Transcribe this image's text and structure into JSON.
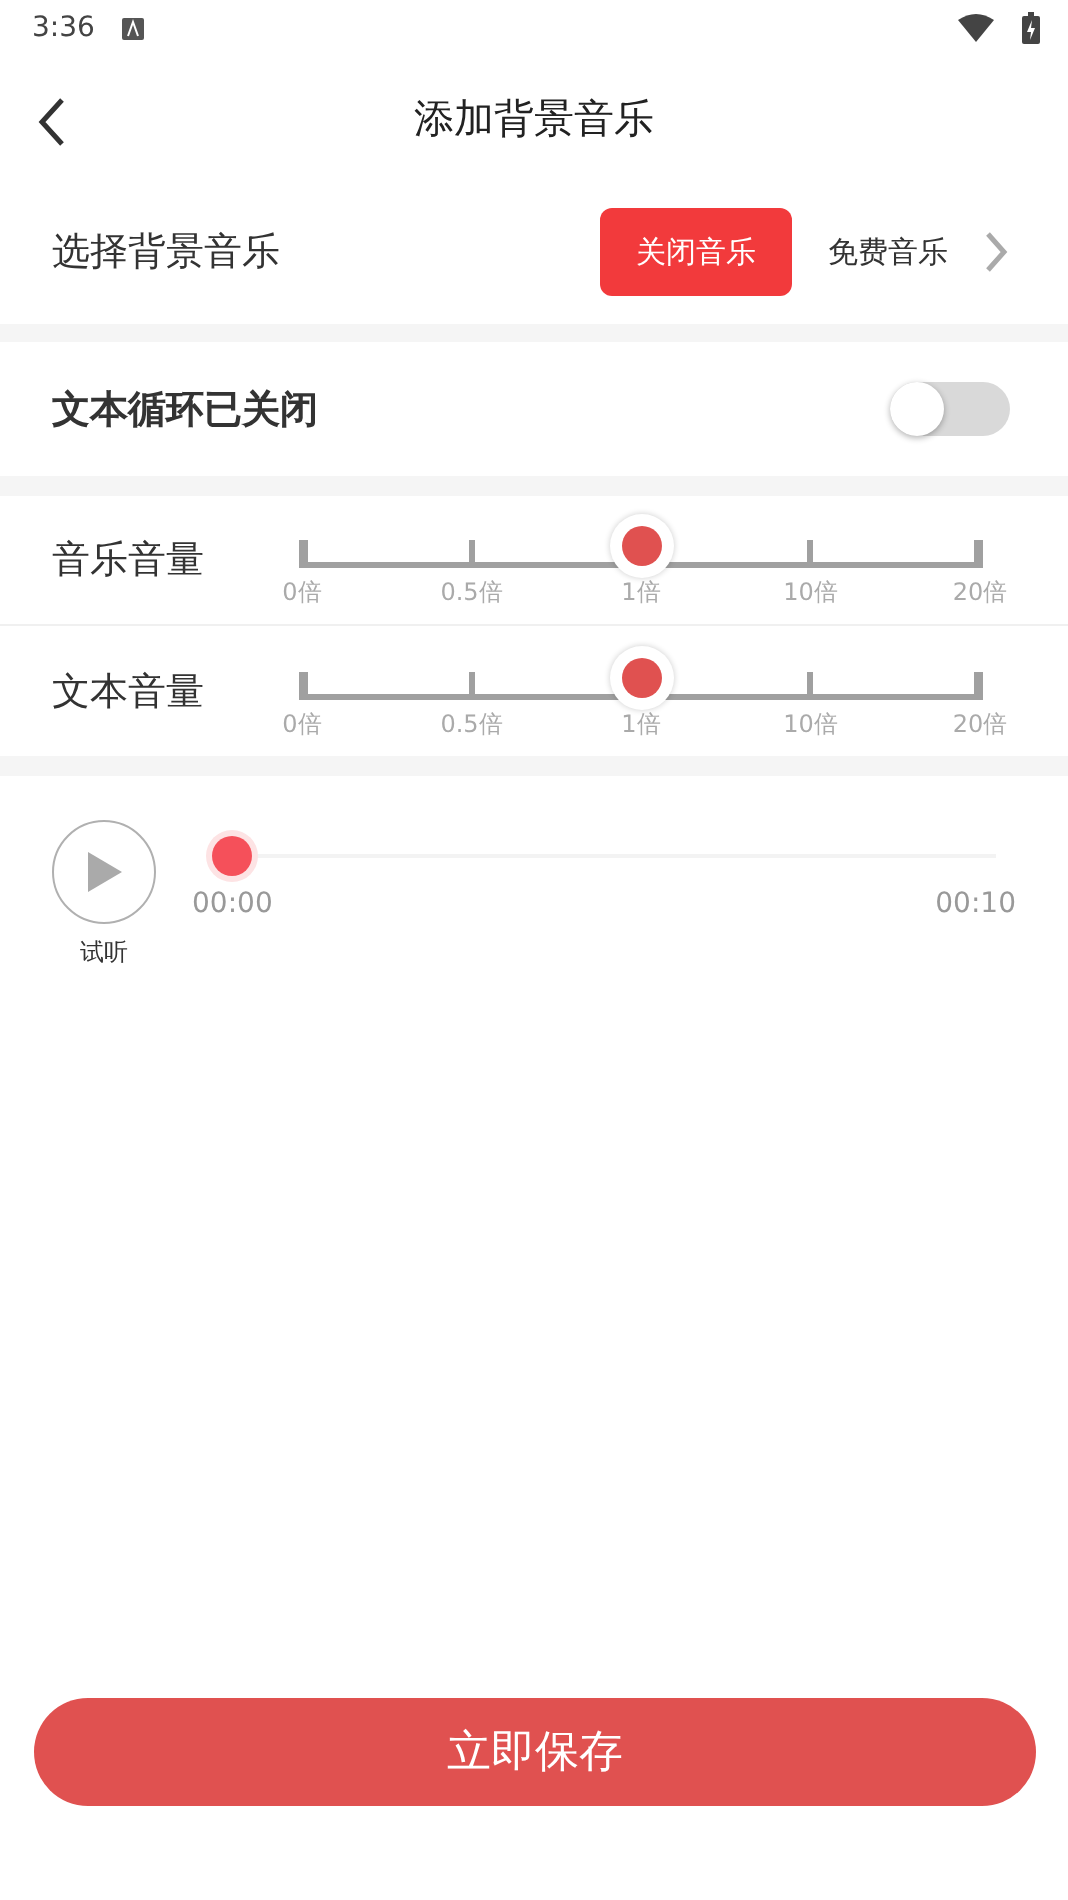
{
  "status_bar": {
    "time": "3:36"
  },
  "header": {
    "title": "添加背景音乐"
  },
  "music_select": {
    "label": "选择背景音乐",
    "options": [
      {
        "label": "关闭音乐",
        "selected": true
      },
      {
        "label": "免费音乐",
        "selected": false
      }
    ]
  },
  "text_loop": {
    "label": "文本循环已关闭",
    "on": false
  },
  "volumes": [
    {
      "label": "音乐音量",
      "level": 0.5,
      "ticks": [
        "0倍",
        "0.5倍",
        "1倍",
        "10倍",
        "20倍"
      ]
    },
    {
      "label": "文本音量",
      "level": 0.5,
      "ticks": [
        "0倍",
        "0.5倍",
        "1倍",
        "10倍",
        "20倍"
      ]
    }
  ],
  "preview": {
    "label": "试听",
    "level": 0,
    "start": "00:00",
    "end": "00:10"
  },
  "save_button": "立即保存"
}
